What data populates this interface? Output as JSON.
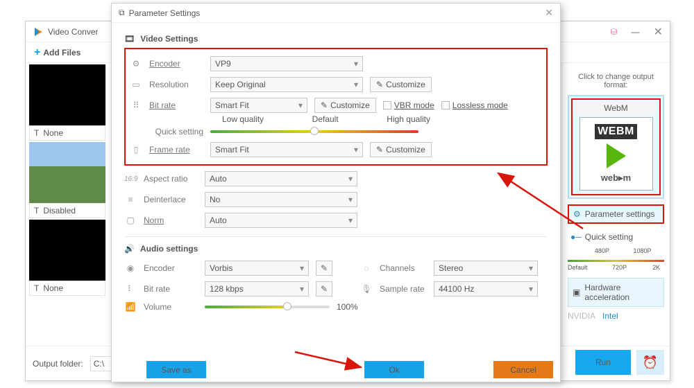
{
  "app": {
    "title": "Video Conver",
    "add_files": "Add Files",
    "output_folder_label": "Output folder:",
    "output_folder_value": "C:\\",
    "run": "Run"
  },
  "thumbs": [
    {
      "label": "None"
    },
    {
      "label": "Disabled"
    },
    {
      "label": "None"
    }
  ],
  "right_panel": {
    "label": "Click to change output format:",
    "format_name": "WebM",
    "badge": "WEBM",
    "foot": "web▸m",
    "param_btn": "Parameter settings",
    "quick_setting": "Quick setting",
    "scale": {
      "p480": "480P",
      "p720": "720P",
      "p1080": "1080P",
      "p2k": "2K",
      "default": "Default"
    },
    "hw_accel": "Hardware acceleration",
    "nvidia": "NVIDIA",
    "intel": "Intel"
  },
  "modal": {
    "title": "Parameter Settings",
    "video_section": "Video Settings",
    "audio_section": "Audio settings",
    "encoder": {
      "label": "Encoder",
      "value": "VP9"
    },
    "resolution": {
      "label": "Resolution",
      "value": "Keep Original",
      "customize": "Customize"
    },
    "bitrate": {
      "label": "Bit rate",
      "value": "Smart Fit",
      "customize": "Customize",
      "vbr": "VBR mode",
      "lossless": "Lossless mode",
      "quick": "Quick setting",
      "low": "Low quality",
      "default": "Default",
      "high": "High quality"
    },
    "framerate": {
      "label": "Frame rate",
      "value": "Smart Fit",
      "customize": "Customize"
    },
    "aspect": {
      "label": "Aspect ratio",
      "value": "Auto",
      "badge": "16:9"
    },
    "deinterlace": {
      "label": "Deinterlace",
      "value": "No"
    },
    "norm": {
      "label": "Norm",
      "value": "Auto"
    },
    "a_encoder": {
      "label": "Encoder",
      "value": "Vorbis"
    },
    "a_channels": {
      "label": "Channels",
      "value": "Stereo"
    },
    "a_bitrate": {
      "label": "Bit rate",
      "value": "128 kbps"
    },
    "a_samplerate": {
      "label": "Sample rate",
      "value": "44100 Hz"
    },
    "a_volume": {
      "label": "Volume",
      "pct": "100%"
    },
    "footer": {
      "save_as": "Save as",
      "ok": "Ok",
      "cancel": "Cancel"
    }
  }
}
